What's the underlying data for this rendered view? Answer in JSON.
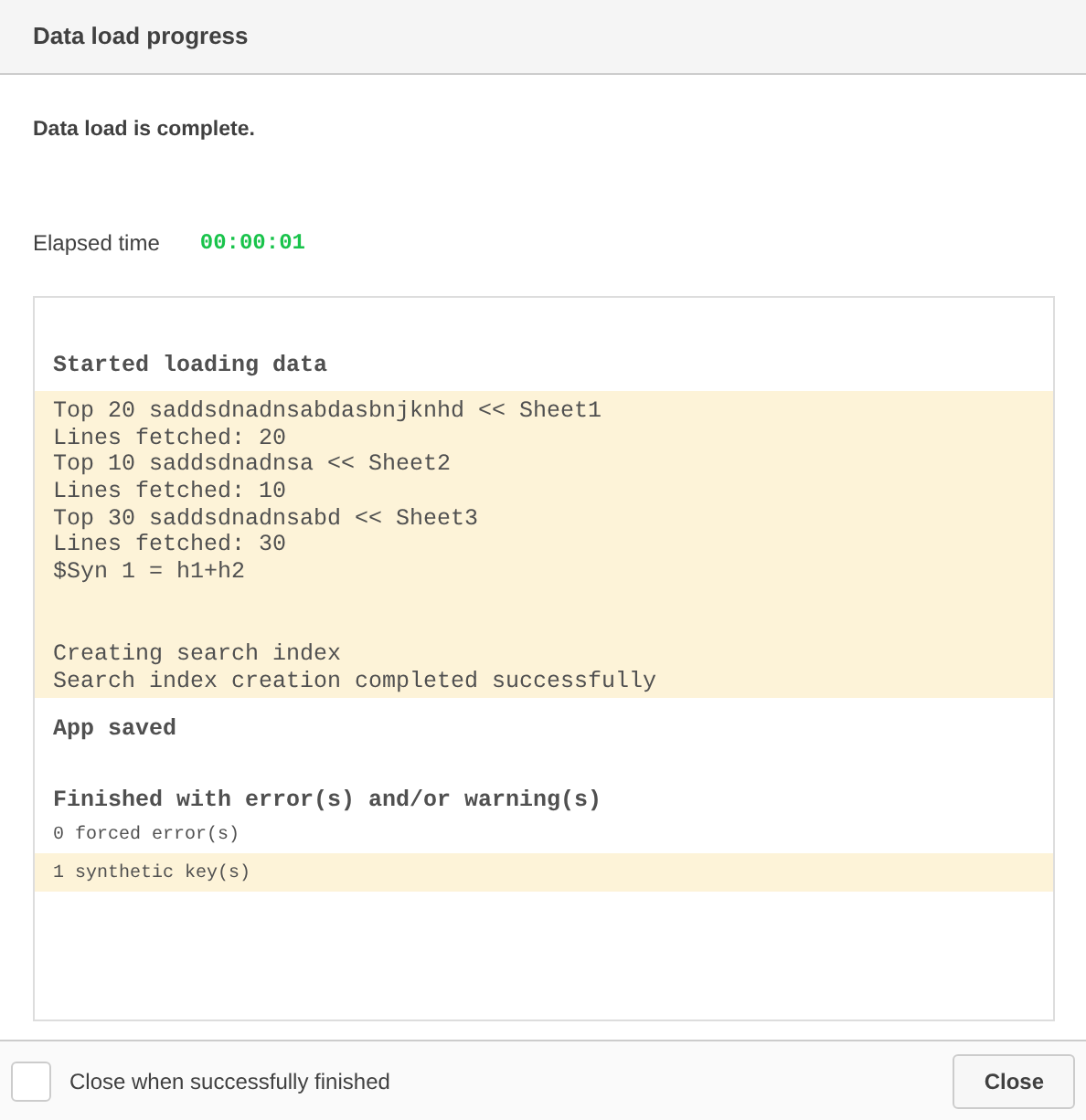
{
  "window": {
    "title": "Data load progress"
  },
  "message": "Data load is complete.",
  "elapsed": {
    "label": "Elapsed time",
    "value": "00:00:01"
  },
  "log": [
    {
      "highlighted": false,
      "lines": [
        {
          "text": "Started loading data",
          "kind": "heading"
        }
      ]
    },
    {
      "highlighted": true,
      "lines": [
        {
          "text": "Top 20 saddsdnadnsabdasbnjknhd << Sheet1",
          "kind": "line"
        },
        {
          "text": "Lines fetched: 20",
          "kind": "line"
        },
        {
          "text": "Top 10 saddsdnadnsa << Sheet2",
          "kind": "line"
        },
        {
          "text": "Lines fetched: 10",
          "kind": "line"
        },
        {
          "text": "Top 30 saddsdnadnsabd << Sheet3",
          "kind": "line"
        },
        {
          "text": "Lines fetched: 30",
          "kind": "line"
        },
        {
          "text": "$Syn 1 = h1+h2",
          "kind": "line"
        },
        {
          "text": "Creating search index",
          "kind": "line",
          "gap_before": true
        },
        {
          "text": "Search index creation completed successfully",
          "kind": "line"
        }
      ]
    },
    {
      "highlighted": false,
      "lines": [
        {
          "text": "App saved",
          "kind": "heading"
        },
        {
          "text": "Finished with error(s) and/or warning(s)",
          "kind": "heading",
          "gap_before": true
        },
        {
          "text": "0 forced error(s)",
          "kind": "small"
        }
      ]
    },
    {
      "highlighted": true,
      "lines": [
        {
          "text": "1 synthetic key(s)",
          "kind": "small"
        }
      ]
    }
  ],
  "footer": {
    "checkbox": {
      "label": "Close when successfully finished",
      "checked": false
    },
    "button": "Close"
  }
}
